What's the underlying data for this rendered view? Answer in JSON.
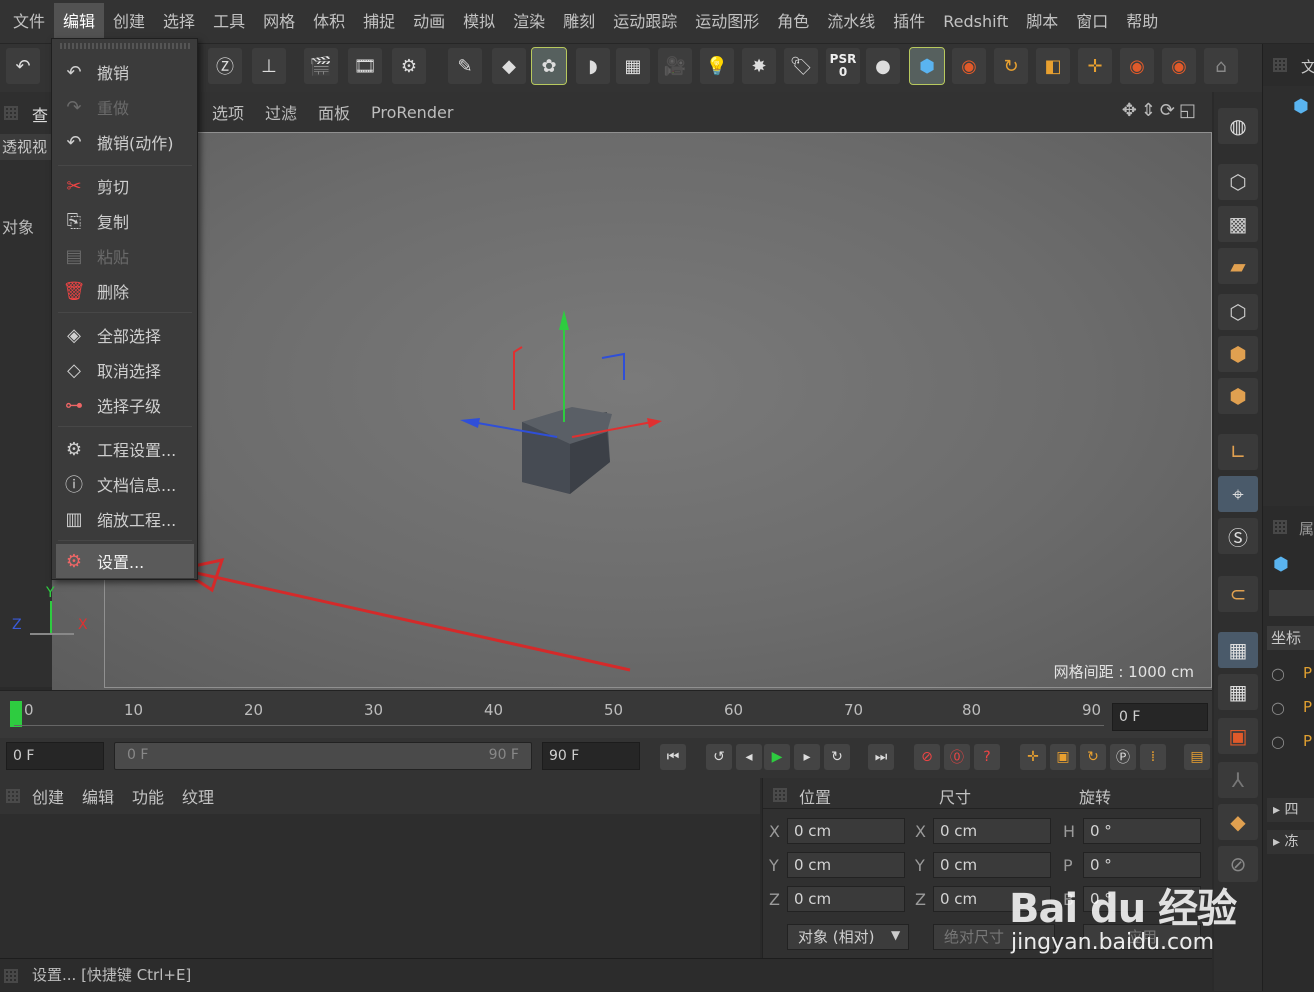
{
  "menubar": [
    "文件",
    "编辑",
    "创建",
    "选择",
    "工具",
    "网格",
    "体积",
    "捕捉",
    "动画",
    "模拟",
    "渲染",
    "雕刻",
    "运动跟踪",
    "运动图形",
    "角色",
    "流水线",
    "插件",
    "Redshift",
    "脚本",
    "窗口",
    "帮助"
  ],
  "left_tabs": {
    "t1": "查",
    "t2": "透视视",
    "t3": "对象"
  },
  "viewport": {
    "menus": [
      "选项",
      "过滤",
      "面板",
      "ProRender"
    ],
    "grid_label": "网格间距 : 1000 cm",
    "axis": {
      "y": "Y",
      "z": "Z",
      "x": "X"
    }
  },
  "toolbar": {
    "psr_label": "PSR",
    "psr_value": "0"
  },
  "edit_menu": {
    "items": [
      {
        "label": "撤销",
        "icon": "undo-icon",
        "state": "normal"
      },
      {
        "label": "重做",
        "icon": "redo-icon",
        "state": "disabled"
      },
      {
        "label": "撤销(动作)",
        "icon": "undo-action-icon",
        "state": "normal"
      },
      {
        "label": "剪切",
        "icon": "scissors-icon",
        "state": "normal"
      },
      {
        "label": "复制",
        "icon": "copy-icon",
        "state": "normal"
      },
      {
        "label": "粘贴",
        "icon": "paste-icon",
        "state": "disabled"
      },
      {
        "label": "删除",
        "icon": "trash-icon",
        "state": "normal"
      },
      {
        "label": "全部选择",
        "icon": "select-all-icon",
        "state": "normal"
      },
      {
        "label": "取消选择",
        "icon": "deselect-icon",
        "state": "normal"
      },
      {
        "label": "选择子级",
        "icon": "select-children-icon",
        "state": "normal"
      },
      {
        "label": "工程设置...",
        "icon": "project-settings-icon",
        "state": "normal"
      },
      {
        "label": "文档信息...",
        "icon": "document-info-icon",
        "state": "normal"
      },
      {
        "label": "缩放工程...",
        "icon": "scale-project-icon",
        "state": "normal"
      },
      {
        "label": "设置...",
        "icon": "settings-icon",
        "state": "selected"
      }
    ]
  },
  "timeline": {
    "ticks": [
      "0",
      "10",
      "20",
      "30",
      "40",
      "50",
      "60",
      "70",
      "80",
      "90"
    ],
    "current_frame_field": "0 F",
    "start_field": "0 F",
    "range_start": "0 F",
    "range_end": "90 F",
    "end_field": "90 F"
  },
  "material_panel": {
    "menus": [
      "创建",
      "编辑",
      "功能",
      "纹理"
    ]
  },
  "coords": {
    "headers": {
      "position": "位置",
      "size": "尺寸",
      "rotation": "旋转"
    },
    "rows": [
      {
        "axis": "X",
        "pos": "0 cm",
        "size_axis": "X",
        "size": "0 cm",
        "rot_axis": "H",
        "rot": "0 °"
      },
      {
        "axis": "Y",
        "pos": "0 cm",
        "size_axis": "Y",
        "size": "0 cm",
        "rot_axis": "P",
        "rot": "0 °"
      },
      {
        "axis": "Z",
        "pos": "0 cm",
        "size_axis": "Z",
        "size": "0 cm",
        "rot_axis": "B",
        "rot": "0 °"
      }
    ],
    "mode_dropdown": "对象 (相对)",
    "size_dropdown": "绝对尺寸",
    "apply_button": "应用"
  },
  "right_panel": {
    "tab1": "文",
    "tab2": "属",
    "coord_label": "坐标",
    "items": [
      "P",
      "P",
      "P"
    ],
    "groups": [
      "四",
      "冻"
    ]
  },
  "status": "设置... [快捷键 Ctrl+E]",
  "watermark": {
    "brand": "Bai du 经验",
    "url": "jingyan.baidu.com"
  },
  "colors": {
    "accent_yellow": "#b8c95e",
    "arrow_red": "#d42a2a",
    "axis_green": "#2ecc40",
    "axis_red": "#e03030",
    "axis_blue": "#2f4fd8"
  }
}
